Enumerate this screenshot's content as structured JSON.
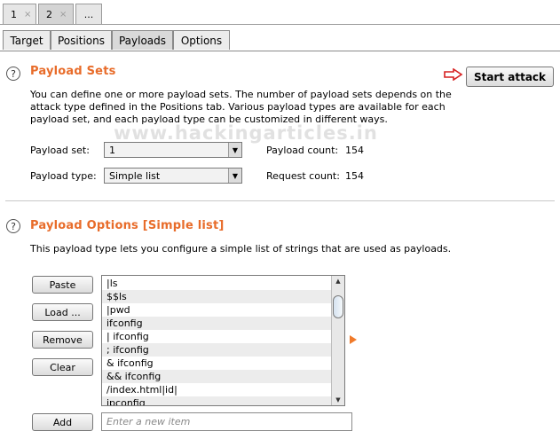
{
  "instance_tabs": [
    {
      "label": "1",
      "close_glyph": "×"
    },
    {
      "label": "2",
      "close_glyph": "×"
    },
    {
      "label": "..."
    }
  ],
  "intruder_tabs": [
    "Target",
    "Positions",
    "Payloads",
    "Options"
  ],
  "watermark": "www.hackingarticles.in",
  "payload_sets": {
    "title": "Payload Sets",
    "start_attack": "Start attack",
    "description": [
      "You can define one or more payload sets. The number of payload sets depends on the",
      "attack type defined in the Positions tab. Various payload types are available for each",
      "payload set, and each payload type can be customized in different ways."
    ],
    "set_label": "Payload set:",
    "set_value": "1",
    "count_label": "Payload count:",
    "count_value": "154",
    "type_label": "Payload type:",
    "type_value": "Simple list",
    "request_label": "Request count:",
    "request_value": "154"
  },
  "payload_options": {
    "title": "Payload Options [Simple list]",
    "description": "This payload type lets you configure a simple list of strings that are used as payloads.",
    "buttons": {
      "paste": "Paste",
      "load": "Load ...",
      "remove": "Remove",
      "clear": "Clear",
      "add": "Add"
    },
    "items": [
      "|ls",
      "$$ls",
      "|pwd",
      "ifconfig",
      "| ifconfig",
      "; ifconfig",
      "& ifconfig",
      "&& ifconfig",
      "/index.html|id|",
      "ipconfig"
    ],
    "new_item_placeholder": "Enter a new item"
  },
  "colors": {
    "accent": "#e86c2a",
    "arrow": "#d62020"
  },
  "icons": {
    "help": "help-icon",
    "arrow": "red-arrow-icon",
    "dropdown": "chevron-down-icon",
    "expand": "orange-triangle-icon"
  }
}
